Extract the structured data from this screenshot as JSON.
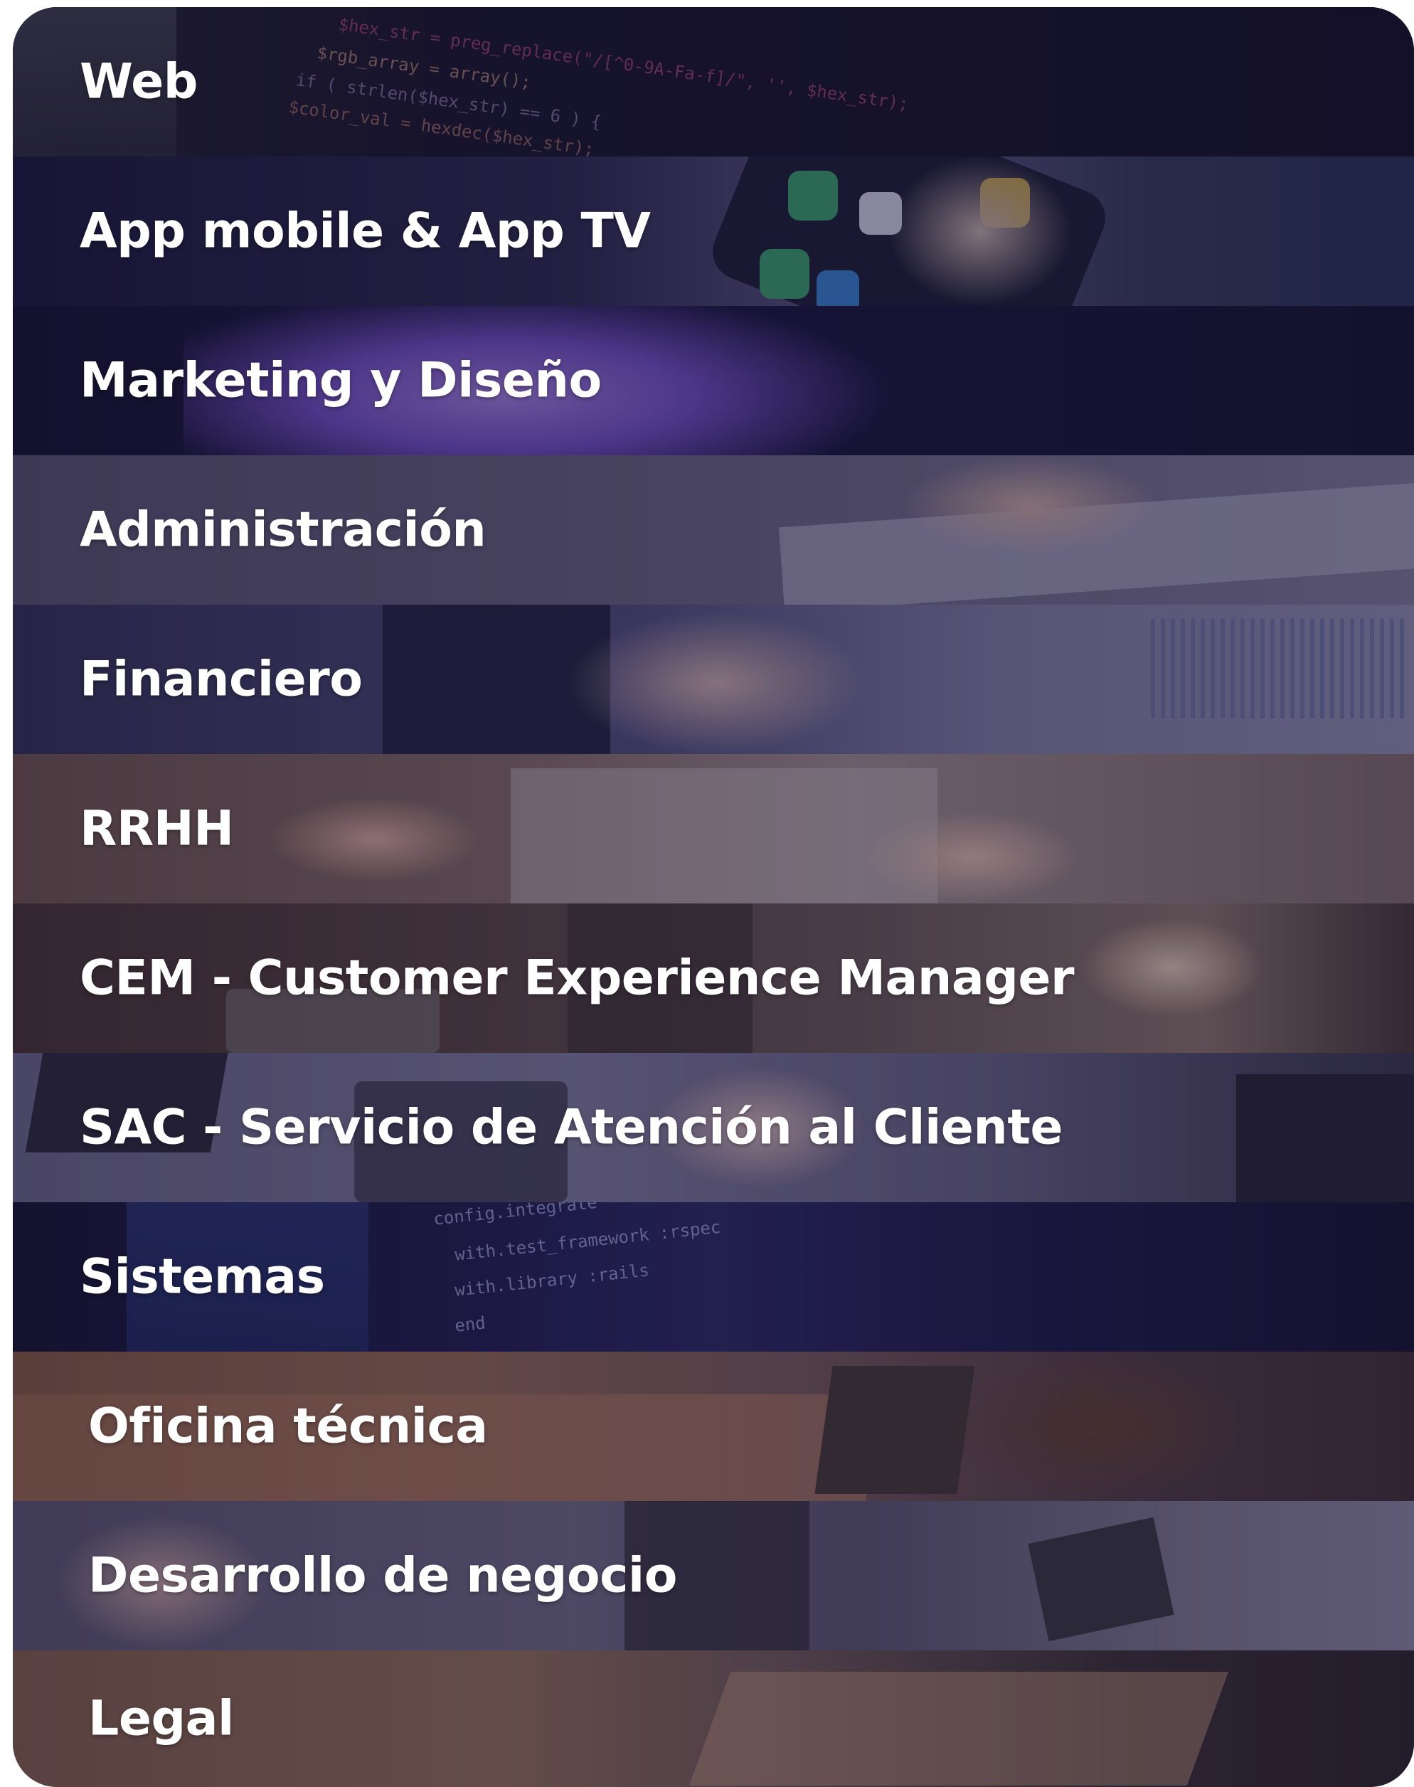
{
  "menu": {
    "items": [
      {
        "label": "Web"
      },
      {
        "label": "App mobile & App TV"
      },
      {
        "label": "Marketing y Diseño"
      },
      {
        "label": "Administración"
      },
      {
        "label": "Financiero"
      },
      {
        "label": "RRHH"
      },
      {
        "label": "CEM - Customer Experience Manager"
      },
      {
        "label": "SAC - Servicio de Atención al Cliente"
      },
      {
        "label": "Sistemas"
      },
      {
        "label": "Oficina técnica"
      },
      {
        "label": "Desarrollo de negocio"
      },
      {
        "label": "Legal"
      }
    ]
  },
  "colors": {
    "label_text": "#ffffff",
    "overlay_navy": "#17133a",
    "overlay_purple": "#3b3466",
    "overlay_brown": "#5a3f3a"
  }
}
